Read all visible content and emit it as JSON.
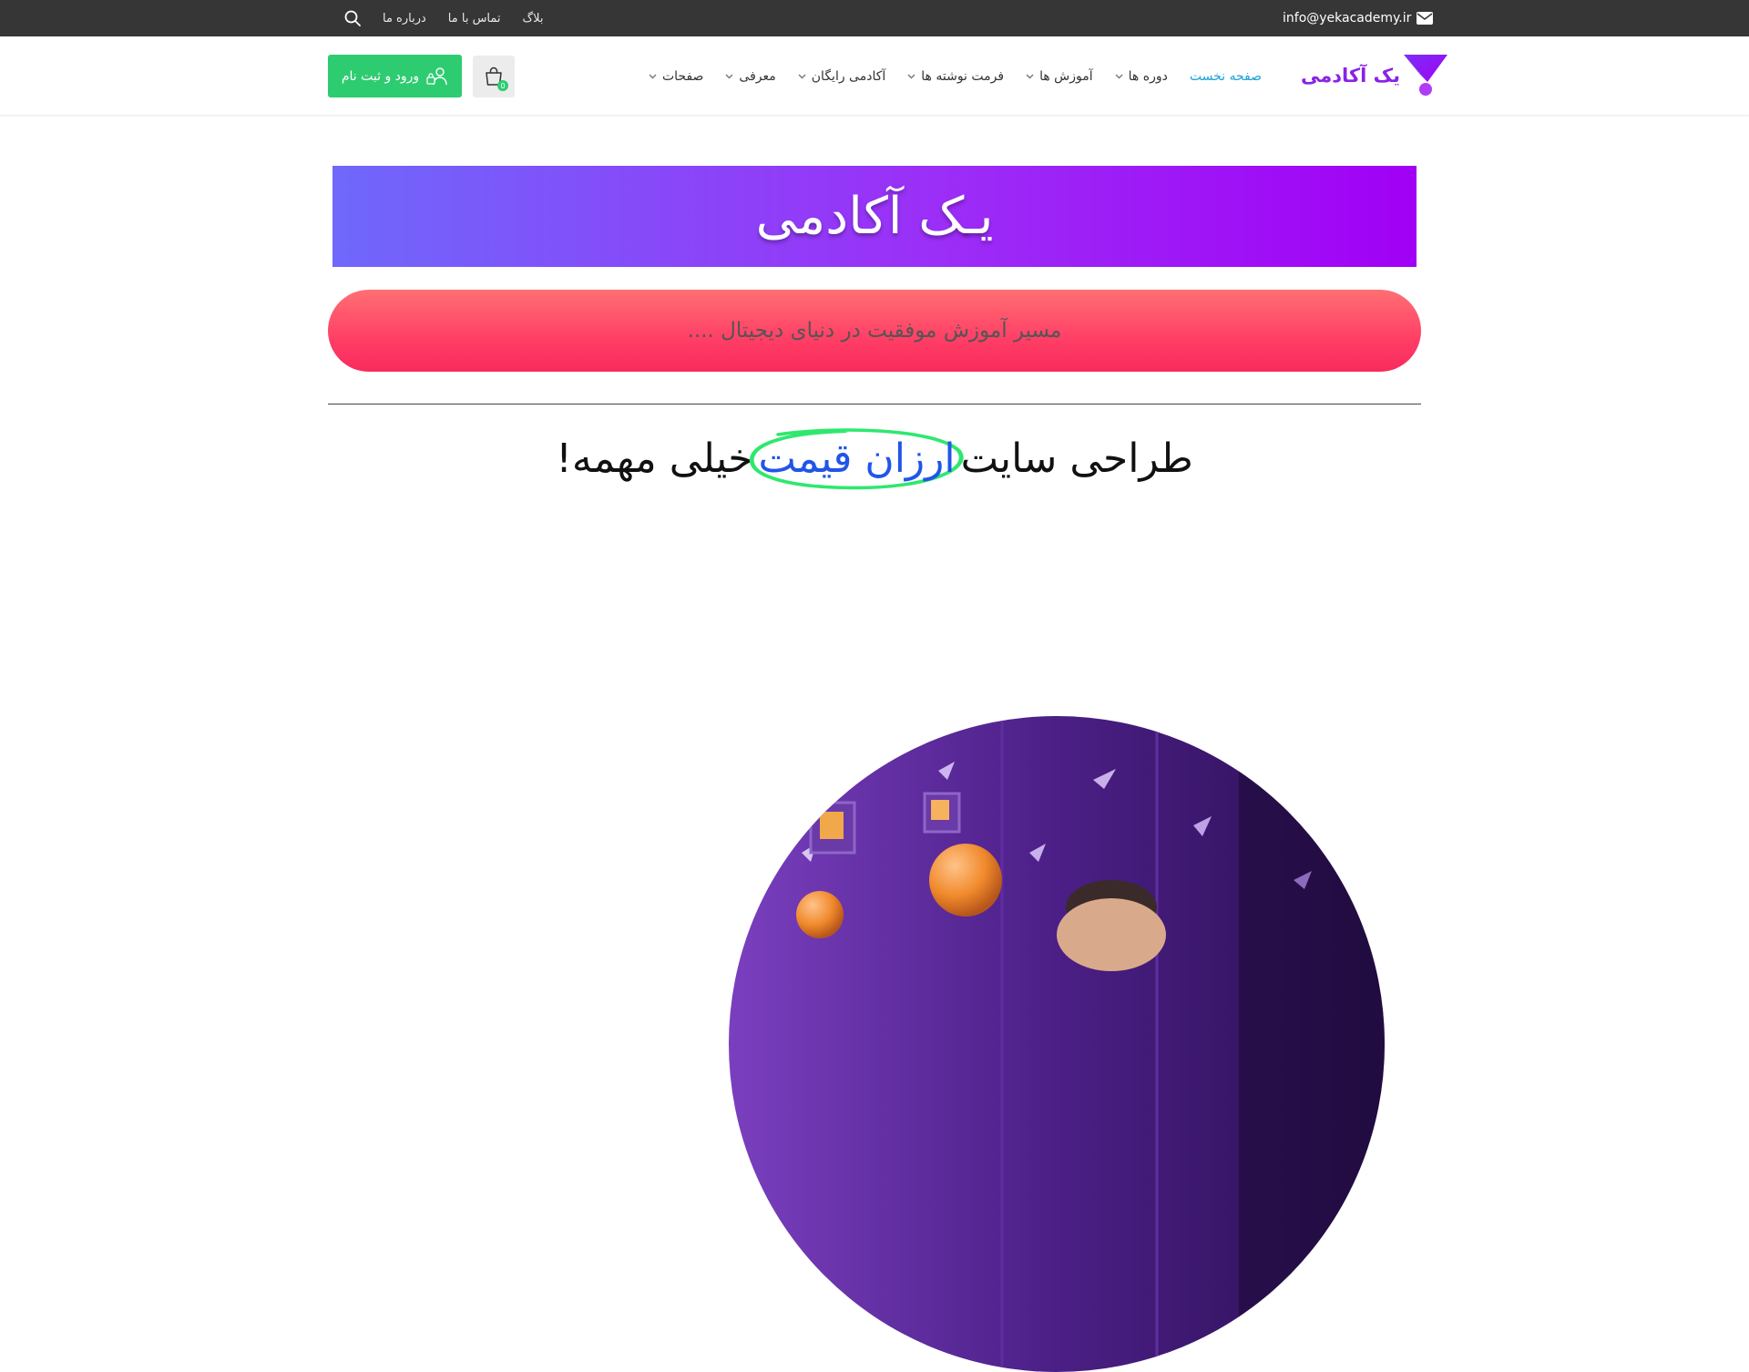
{
  "topbar": {
    "email": "info@yekacademy.ir",
    "links": [
      "بلاگ",
      "تماس با ما",
      "درباره ما"
    ]
  },
  "header": {
    "logo_text": "یک آکادمی",
    "nav": [
      {
        "label": "صفحه نخست",
        "active": true,
        "dropdown": false
      },
      {
        "label": "دوره ها",
        "active": false,
        "dropdown": true
      },
      {
        "label": "آموزش ها",
        "active": false,
        "dropdown": true
      },
      {
        "label": "فرمت نوشته ها",
        "active": false,
        "dropdown": true
      },
      {
        "label": "آکادمی رایگان",
        "active": false,
        "dropdown": true
      },
      {
        "label": "معرفی",
        "active": false,
        "dropdown": true
      },
      {
        "label": "صفحات",
        "active": false,
        "dropdown": true
      }
    ],
    "cart_count": "0",
    "login_label": "ورود و ثبت نام"
  },
  "hero": {
    "title": "یـک آکادمی",
    "tagline": "مسیر آموزش موفقیت در دنیای دیجیتال ....",
    "headline_before": "طراحی سایت",
    "headline_highlight": "ارزان قیمت",
    "headline_after": "خیلی مهمه!"
  },
  "colors": {
    "topbar_bg": "#363636",
    "nav_active": "#1ba0d8",
    "logo": "#8a22e6",
    "login_button": "#2ecc71",
    "banner_start": "#6f68fb",
    "banner_end": "#a100f5",
    "tagline_start": "#ff6f73",
    "tagline_end": "#f82a5c",
    "highlight_text": "#2155e8",
    "highlight_circle": "#2ee86e"
  },
  "icons": {
    "email": "envelope-icon",
    "search": "search-icon",
    "cart": "shopping-bag-icon",
    "login": "user-lock-icon",
    "dropdown": "chevron-down-icon"
  }
}
